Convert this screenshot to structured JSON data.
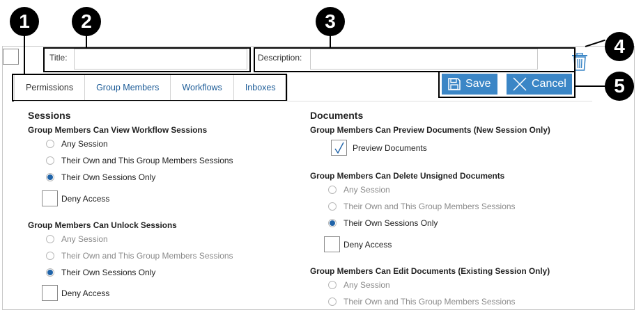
{
  "callouts": [
    "1",
    "2",
    "3",
    "4",
    "5"
  ],
  "header": {
    "title_label": "Title:",
    "title_value": "",
    "description_label": "Description:",
    "description_value": ""
  },
  "tabs": [
    {
      "label": "Permissions",
      "active": true
    },
    {
      "label": "Group Members",
      "active": false
    },
    {
      "label": "Workflows",
      "active": false
    },
    {
      "label": "Inboxes",
      "active": false
    }
  ],
  "toolbar": {
    "save_label": "Save",
    "cancel_label": "Cancel",
    "accent": "#3b86c6"
  },
  "sessions": {
    "title": "Sessions",
    "view": {
      "title": "Group Members Can View Workflow Sessions",
      "options": [
        "Any Session",
        "Their Own and This Group Members Sessions",
        "Their Own Sessions Only"
      ],
      "selected": 2,
      "deny": "Deny Access"
    },
    "unlock": {
      "title": "Group Members Can Unlock Sessions",
      "options": [
        "Any Session",
        "Their Own and This Group Members Sessions",
        "Their Own Sessions Only"
      ],
      "selected": 2,
      "deny": "Deny Access"
    }
  },
  "documents": {
    "title": "Documents",
    "preview": {
      "title": "Group Members Can Preview Documents (New Session Only)",
      "checkbox_label": "Preview Documents",
      "checked": true
    },
    "delete": {
      "title": "Group Members Can Delete Unsigned Documents",
      "options": [
        "Any Session",
        "Their Own and This Group Members Sessions",
        "Their Own Sessions Only"
      ],
      "selected": 2,
      "deny": "Deny Access"
    },
    "edit": {
      "title": "Group Members Can Edit Documents (Existing Session Only)",
      "options": [
        "Any Session",
        "Their Own and This Group Members Sessions"
      ]
    }
  }
}
